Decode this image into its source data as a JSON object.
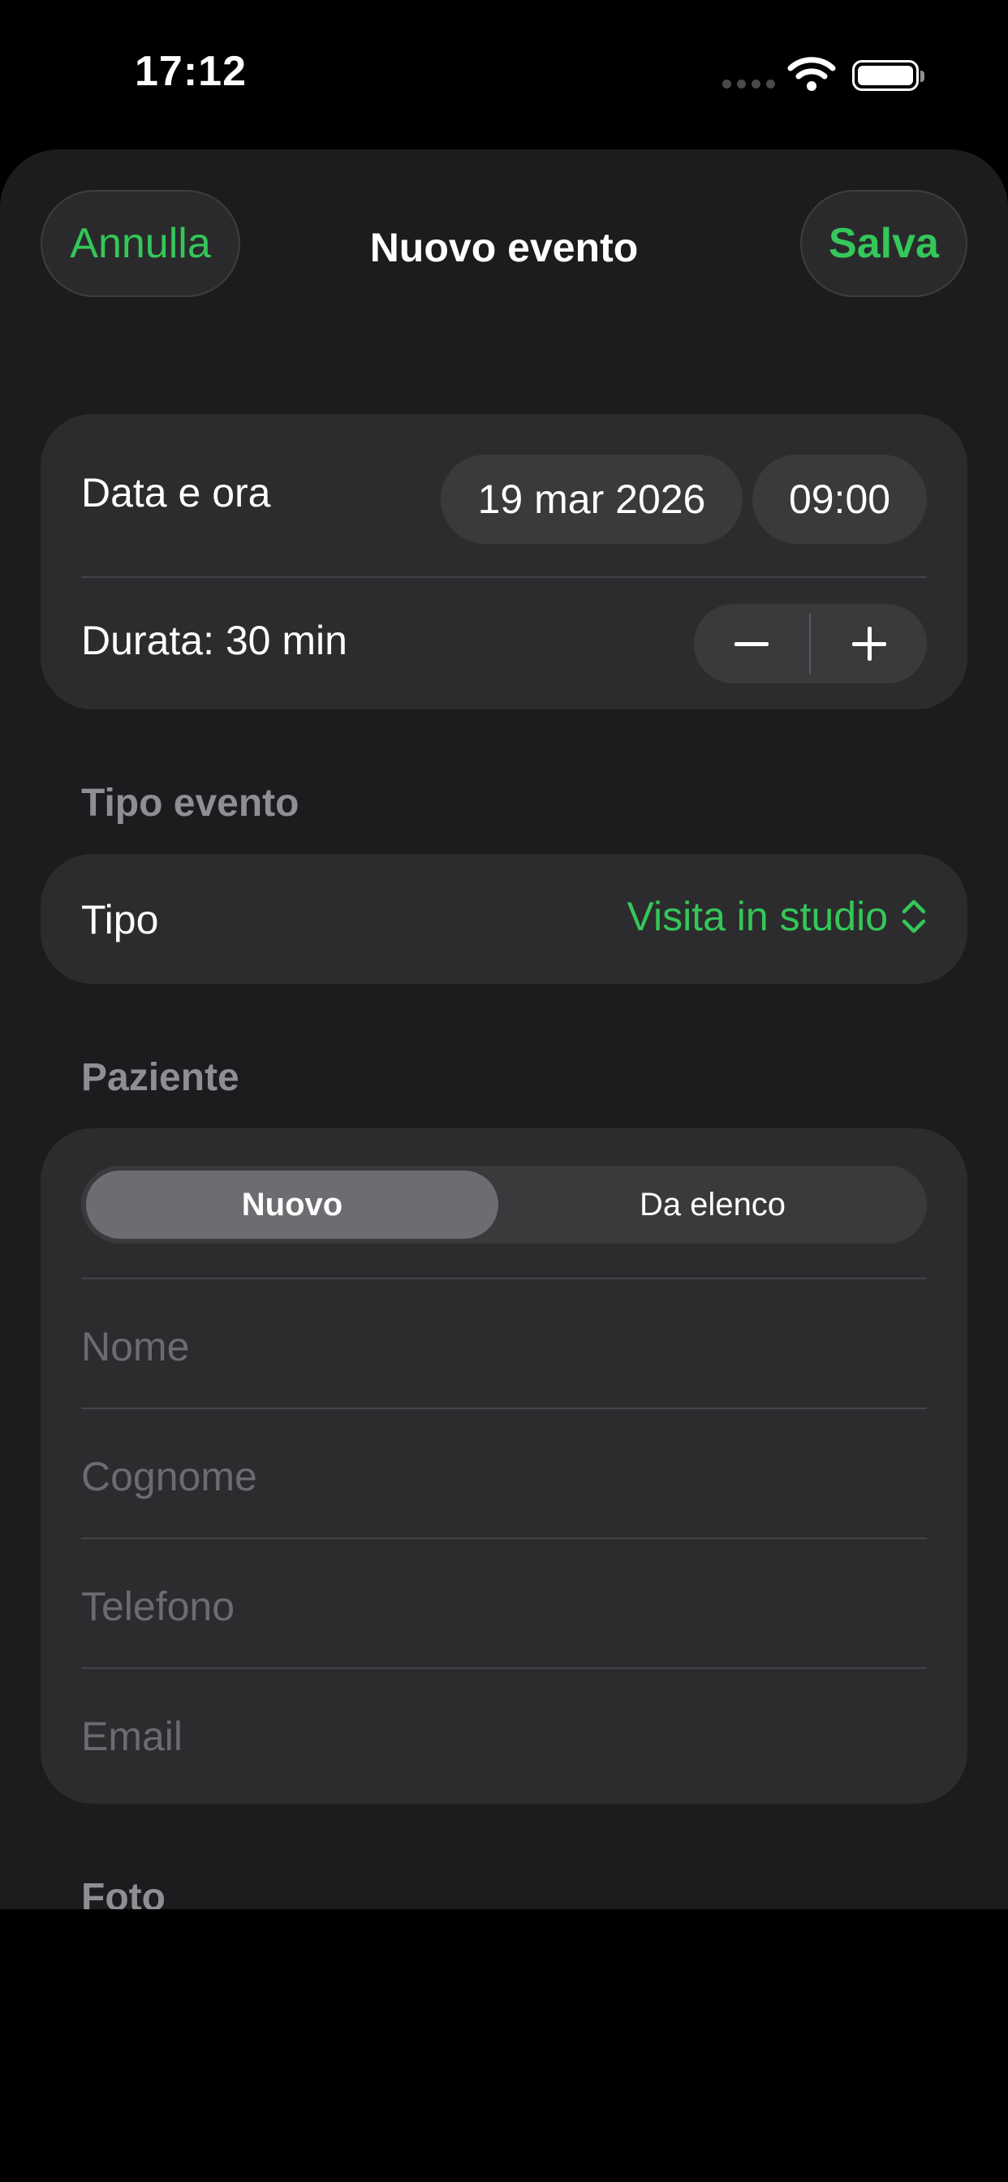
{
  "status_bar": {
    "time": "17:12"
  },
  "nav": {
    "cancel_label": "Annulla",
    "title": "Nuovo evento",
    "save_label": "Salva"
  },
  "datetime": {
    "label": "Data e ora",
    "date": "19 mar 2026",
    "time": "09:00",
    "duration_label": "Durata: 30 min"
  },
  "event_type": {
    "section_title": "Tipo evento",
    "label": "Tipo",
    "value": "Visita in studio"
  },
  "patient": {
    "section_title": "Paziente",
    "segments": [
      "Nuovo",
      "Da elenco"
    ],
    "selected_segment": "Nuovo",
    "fields": [
      {
        "placeholder": "Nome",
        "value": ""
      },
      {
        "placeholder": "Cognome",
        "value": ""
      },
      {
        "placeholder": "Telefono",
        "value": ""
      },
      {
        "placeholder": "Email",
        "value": ""
      }
    ]
  },
  "photo": {
    "section_title": "Foto"
  },
  "colors": {
    "accent": "#34c759",
    "sheet_bg": "#1c1c1e",
    "card_bg": "#2c2c2e"
  }
}
